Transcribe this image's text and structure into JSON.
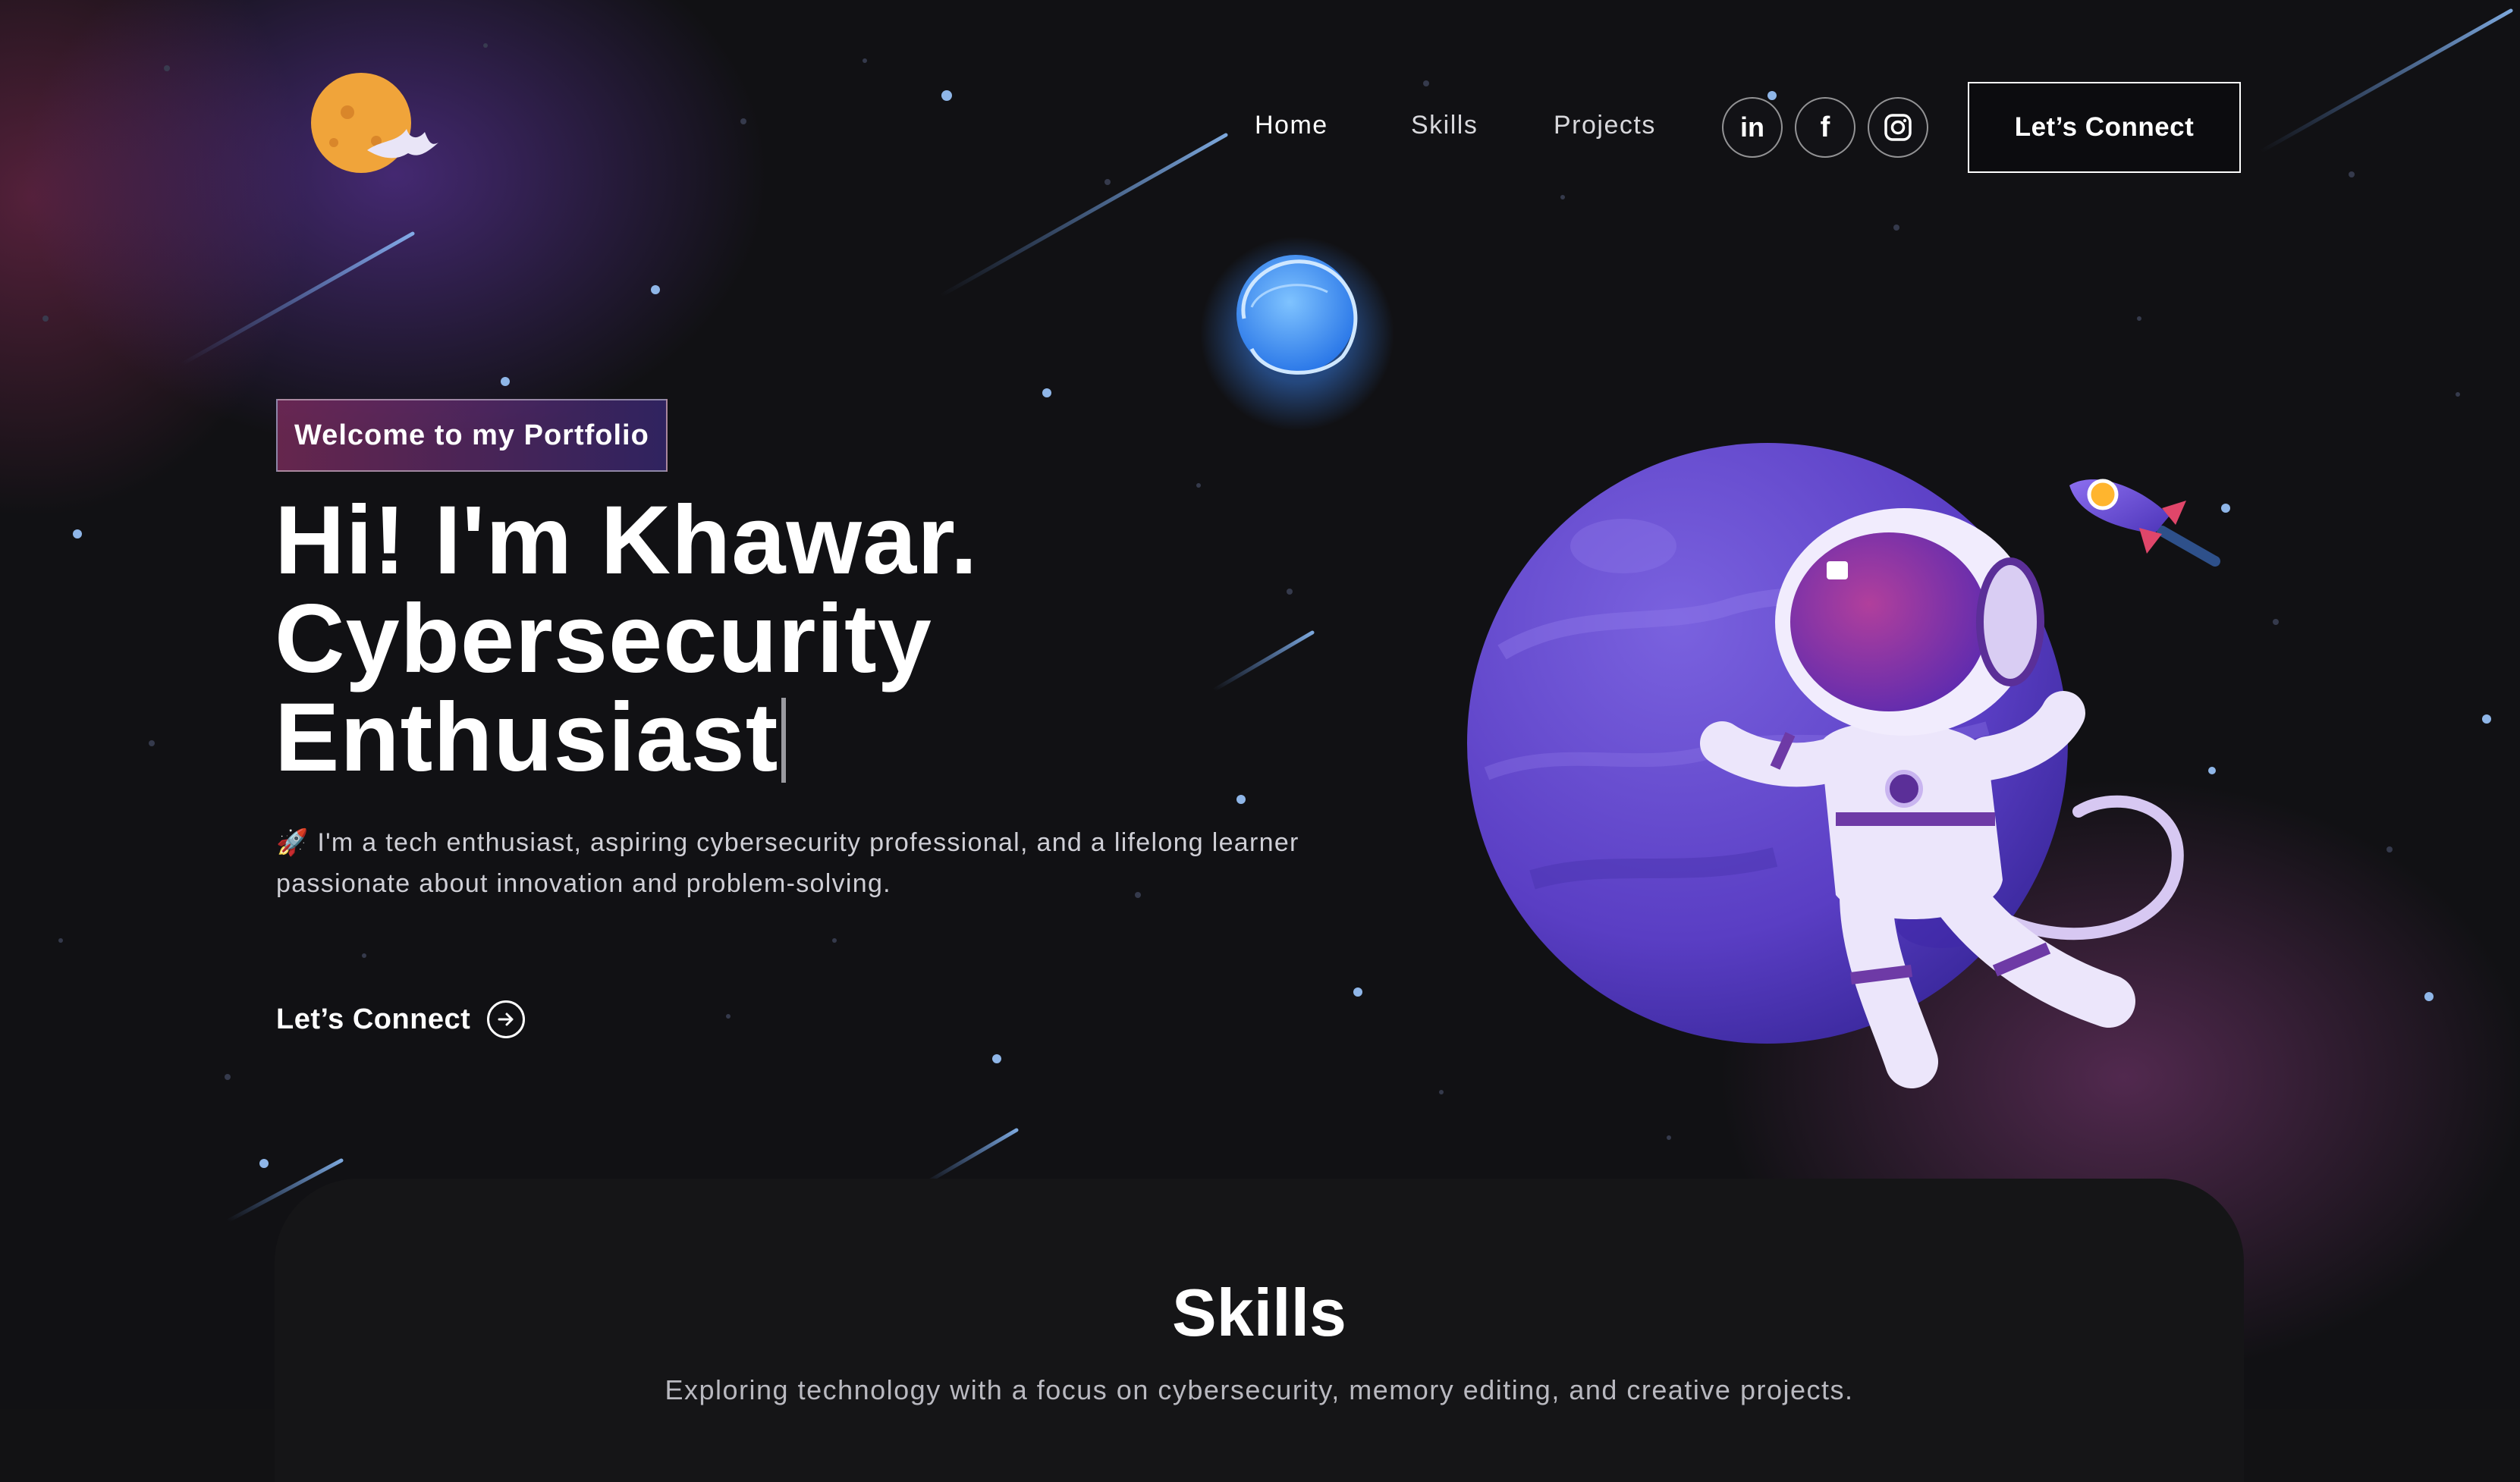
{
  "nav": {
    "links": [
      {
        "label": "Home",
        "active": true
      },
      {
        "label": "Skills",
        "active": false
      },
      {
        "label": "Projects",
        "active": false
      }
    ],
    "socials": [
      {
        "icon": "linkedin-icon",
        "glyph": "in"
      },
      {
        "icon": "facebook-icon",
        "glyph": "f"
      },
      {
        "icon": "instagram-icon",
        "glyph": ""
      }
    ],
    "connect_label": "Let’s Connect"
  },
  "hero": {
    "tagline": "Welcome to my Portfolio",
    "title_lines": [
      "Hi! I'm Khawar.",
      "Cybersecurity",
      "Enthusiast"
    ],
    "description_emoji": "🚀",
    "description": "I'm a tech enthusiast, aspiring cybersecurity professional, and a lifelong learner passionate about innovation and problem-solving.",
    "cta_label": "Let’s Connect"
  },
  "skills": {
    "title": "Skills",
    "subtitle": "Exploring technology with a focus on cybersecurity, memory editing, and creative projects."
  },
  "colors": {
    "background": "#111114",
    "tagline_gradient_start": "#aa367c",
    "tagline_gradient_end": "#4a2fbd",
    "planet_purple": "#6a4fd0",
    "moon_orange": "#f0a43a"
  }
}
